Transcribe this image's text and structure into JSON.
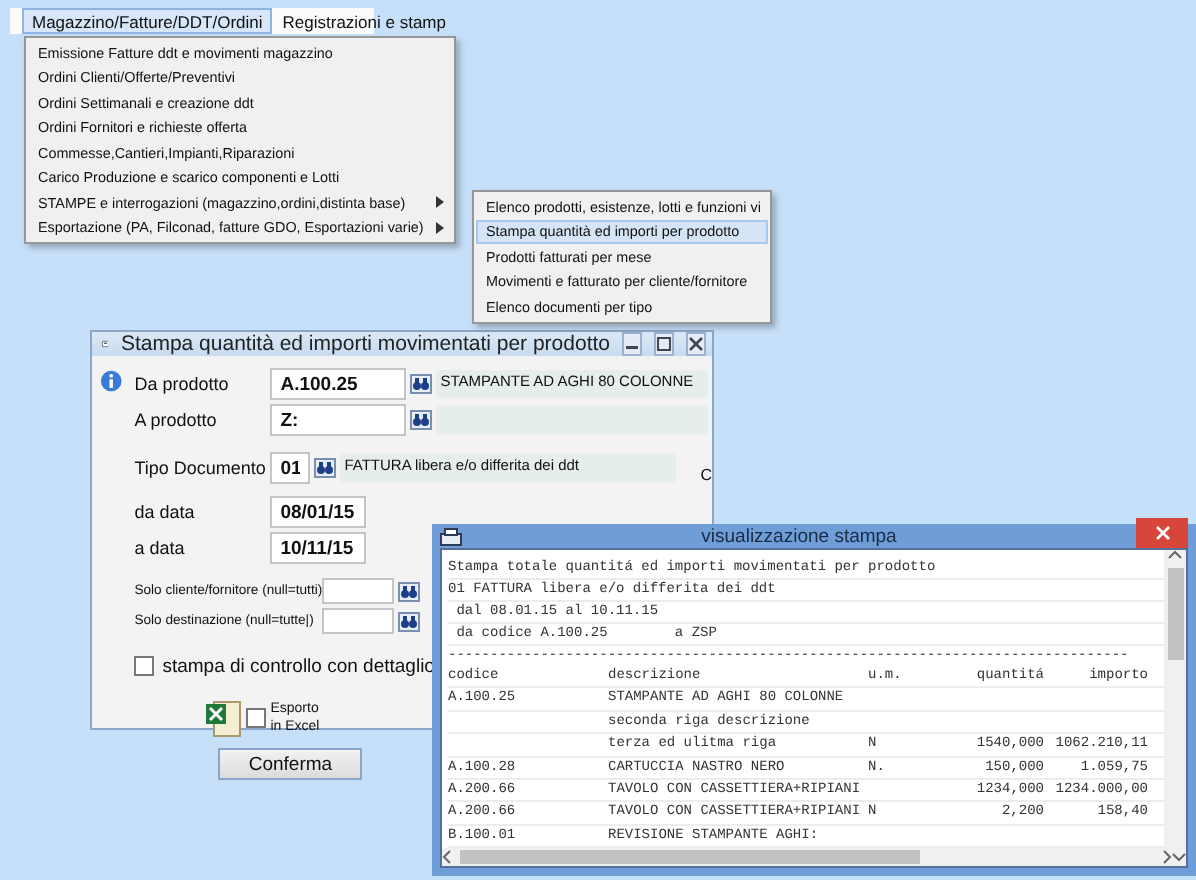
{
  "menubar": {
    "items": [
      {
        "label": "Magazzino/Fatture/DDT/Ordini",
        "selected": true
      },
      {
        "label": "Registrazioni e stamp",
        "selected": false
      }
    ]
  },
  "menu": {
    "items": [
      {
        "label": "Emissione Fatture ddt e movimenti magazzino",
        "submenu": false,
        "selected": false
      },
      {
        "label": "Ordini Clienti/Offerte/Preventivi",
        "submenu": false,
        "selected": false
      },
      {
        "label": "Ordini Settimanali e creazione ddt",
        "submenu": false,
        "selected": false
      },
      {
        "label": "Ordini Fornitori e richieste offerta",
        "submenu": false,
        "selected": false
      },
      {
        "label": "Commesse,Cantieri,Impianti,Riparazioni",
        "submenu": false,
        "selected": false
      },
      {
        "label": "Carico Produzione e scarico componenti e Lotti",
        "submenu": false,
        "selected": false
      },
      {
        "label": "STAMPE e interrogazioni (magazzino,ordini,distinta base)",
        "submenu": true,
        "selected": false
      },
      {
        "label": "Esportazione (PA, Filconad, fatture GDO, Esportazioni varie)",
        "submenu": true,
        "selected": false
      }
    ]
  },
  "submenu": {
    "items": [
      {
        "label": "Elenco prodotti, esistenze, lotti e funzioni vi",
        "selected": false
      },
      {
        "label": "Stampa quantità ed importi per prodotto",
        "selected": true
      },
      {
        "label": "Prodotti fatturati per mese",
        "selected": false
      },
      {
        "label": "Movimenti e fatturato per cliente/fornitore",
        "selected": false
      },
      {
        "label": "Elenco documenti per tipo",
        "selected": false
      }
    ]
  },
  "dialog": {
    "title": "Stampa quantità ed importi movimentati per prodotto",
    "lookups": [
      {
        "label": "Da prodotto",
        "value": "A.100.25",
        "description": "STAMPANTE AD AGHI 80 COLONNE"
      },
      {
        "label": "A prodotto",
        "value": "Z:"
      }
    ],
    "doc_type": {
      "label": "Tipo Documento",
      "value": "01",
      "description": "FATTURA libera e/o differita dei ddt",
      "code": "C"
    },
    "dates": [
      {
        "label": "da data",
        "value": "08/01/15"
      },
      {
        "label": "a data",
        "value": "10/11/15"
      }
    ],
    "filters": [
      {
        "label": "Solo cliente/fornitore (null=tutti)"
      },
      {
        "label": "Solo destinazione (null=tutte|)"
      }
    ],
    "detail_check": {
      "label": "stampa di controllo con dettaglio",
      "checked": false
    },
    "excel_check": {
      "label": "Esporto in Excel",
      "checked": false
    },
    "confirm": "Conferma"
  },
  "preview": {
    "title": "visualizzazione stampa",
    "header": [
      "Stampa totale quantitá ed importi movimentati per prodotto",
      "01 FATTURA libera e/o differita dei ddt",
      " dal 08.01.15 al 10.11.15",
      " da codice A.100.25        a ZSP"
    ],
    "rule": "---------------------------------------------------------------------------------",
    "columns": [
      "codice",
      "descrizione",
      "u.m.",
      "quantitá",
      "importo"
    ],
    "rows": [
      [
        "A.100.25",
        "STAMPANTE AD AGHI 80 COLONNE",
        "",
        "",
        ""
      ],
      [
        "",
        "seconda riga descrizione",
        "",
        "",
        ""
      ],
      [
        "",
        "terza ed ulitma riga",
        "N",
        "1540,000",
        "1062.210,11"
      ],
      [
        "A.100.28",
        "CARTUCCIA NASTRO NERO",
        "N.",
        "150,000",
        "1.059,75"
      ],
      [
        "A.200.66",
        "TAVOLO CON CASSETTIERA+RIPIANI",
        "",
        "1234,000",
        "1234.000,00"
      ],
      [
        "A.200.66",
        "TAVOLO CON CASSETTIERA+RIPIANI",
        "N",
        "2,200",
        "158,40"
      ],
      [
        "B.100.01",
        "REVISIONE STAMPANTE AGHI:",
        "",
        "",
        ""
      ]
    ]
  }
}
